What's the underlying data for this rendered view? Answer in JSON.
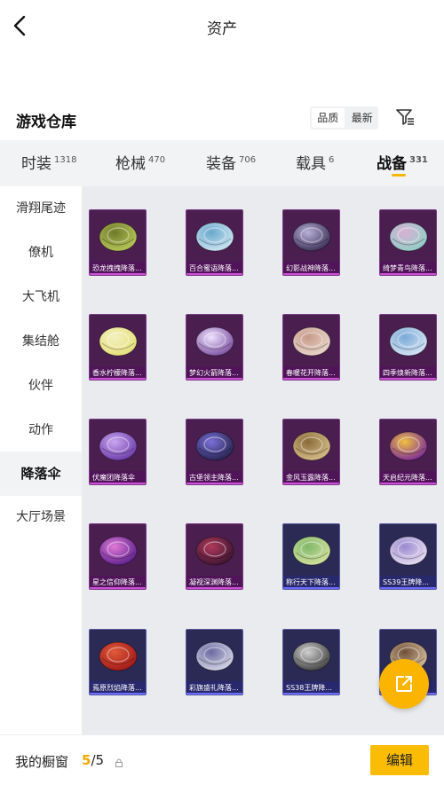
{
  "header": {
    "title": "资产",
    "back_icon": "back-arrow-icon"
  },
  "section": {
    "title": "游戏仓库",
    "sort_options": [
      "品质",
      "最新"
    ],
    "sort_active": "品质",
    "filter_icon": "filter-icon"
  },
  "category_tabs": [
    {
      "label": "时装",
      "count": "1318"
    },
    {
      "label": "枪械",
      "count": "470"
    },
    {
      "label": "装备",
      "count": "706"
    },
    {
      "label": "载具",
      "count": "6"
    },
    {
      "label": "战备",
      "count": "331",
      "active": true
    }
  ],
  "sidebar": {
    "items": [
      "滑翔尾迹",
      "僚机",
      "大飞机",
      "集结舱",
      "伙伴",
      "动作",
      "降落伞",
      "大厅场景"
    ],
    "active": "降落伞"
  },
  "items": [
    {
      "label": "恐龙拽拽降落...",
      "tier": "purple",
      "colors": [
        "#b9c85a",
        "#6f7a2a"
      ]
    },
    {
      "label": "百合蜜语降落...",
      "tier": "purple",
      "colors": [
        "#cfe6f2",
        "#6aa8cc"
      ]
    },
    {
      "label": "幻影战神降落...",
      "tier": "purple",
      "colors": [
        "#3b2e55",
        "#b7b0d8"
      ]
    },
    {
      "label": "绮梦青鸟降落...",
      "tier": "purple",
      "colors": [
        "#8fd0c6",
        "#d9b0d4"
      ]
    },
    {
      "label": "香水柠檬降落...",
      "tier": "purple",
      "colors": [
        "#e6e07a",
        "#f3f0c0"
      ]
    },
    {
      "label": "梦幻火箭降落...",
      "tier": "purple",
      "colors": [
        "#7b4fa0",
        "#efe3ff"
      ]
    },
    {
      "label": "春暖花开降落...",
      "tier": "purple",
      "colors": [
        "#e9d8cc",
        "#c79a8a"
      ]
    },
    {
      "label": "四季焕新降落...",
      "tier": "purple",
      "colors": [
        "#d9e6f3",
        "#7aa9d8"
      ]
    },
    {
      "label": "伏魔团降落伞",
      "tier": "purple",
      "colors": [
        "#6b3aa8",
        "#c9a6f0"
      ]
    },
    {
      "label": "古堡领主降落...",
      "tier": "purple",
      "colors": [
        "#25224d",
        "#7b70d8"
      ]
    },
    {
      "label": "金风玉露降落...",
      "tier": "purple",
      "colors": [
        "#d8c08a",
        "#8a6a3a"
      ]
    },
    {
      "label": "天启纪元降落...",
      "tier": "purple",
      "colors": [
        "#7a2a9a",
        "#f0c040"
      ]
    },
    {
      "label": "星之信仰降落...",
      "tier": "purple",
      "colors": [
        "#5b1f8a",
        "#e07ad8"
      ]
    },
    {
      "label": "凝视深渊降落...",
      "tier": "purple",
      "colors": [
        "#3a1430",
        "#b03a5a"
      ]
    },
    {
      "label": "称行天下降落...",
      "tier": "blue",
      "colors": [
        "#d6e2a0",
        "#7fb86a"
      ]
    },
    {
      "label": "SS39王牌降...",
      "tier": "blue",
      "colors": [
        "#e8e0f0",
        "#9a8ad0"
      ]
    },
    {
      "label": "焉原烈焰降落...",
      "tier": "blue",
      "colors": [
        "#a01818",
        "#e05a3a"
      ]
    },
    {
      "label": "彩旗盛礼降落...",
      "tier": "blue",
      "colors": [
        "#d8d8e8",
        "#6a6aa0"
      ]
    },
    {
      "label": "SS38王牌降...",
      "tier": "blue",
      "colors": [
        "#404040",
        "#cfcfcf"
      ]
    },
    {
      "label": "",
      "tier": "blue",
      "colors": [
        "#d8c0a0",
        "#705038"
      ]
    }
  ],
  "fab": {
    "icon": "share-external-icon"
  },
  "bottom": {
    "label": "我的橱窗",
    "count_current": "5",
    "count_total": "/5",
    "lock_icon": "lock-icon",
    "edit_label": "编辑"
  },
  "colors": {
    "accent": "#fbbc05",
    "purple_tier": "#4a1f4f",
    "blue_tier": "#2a2a55"
  }
}
